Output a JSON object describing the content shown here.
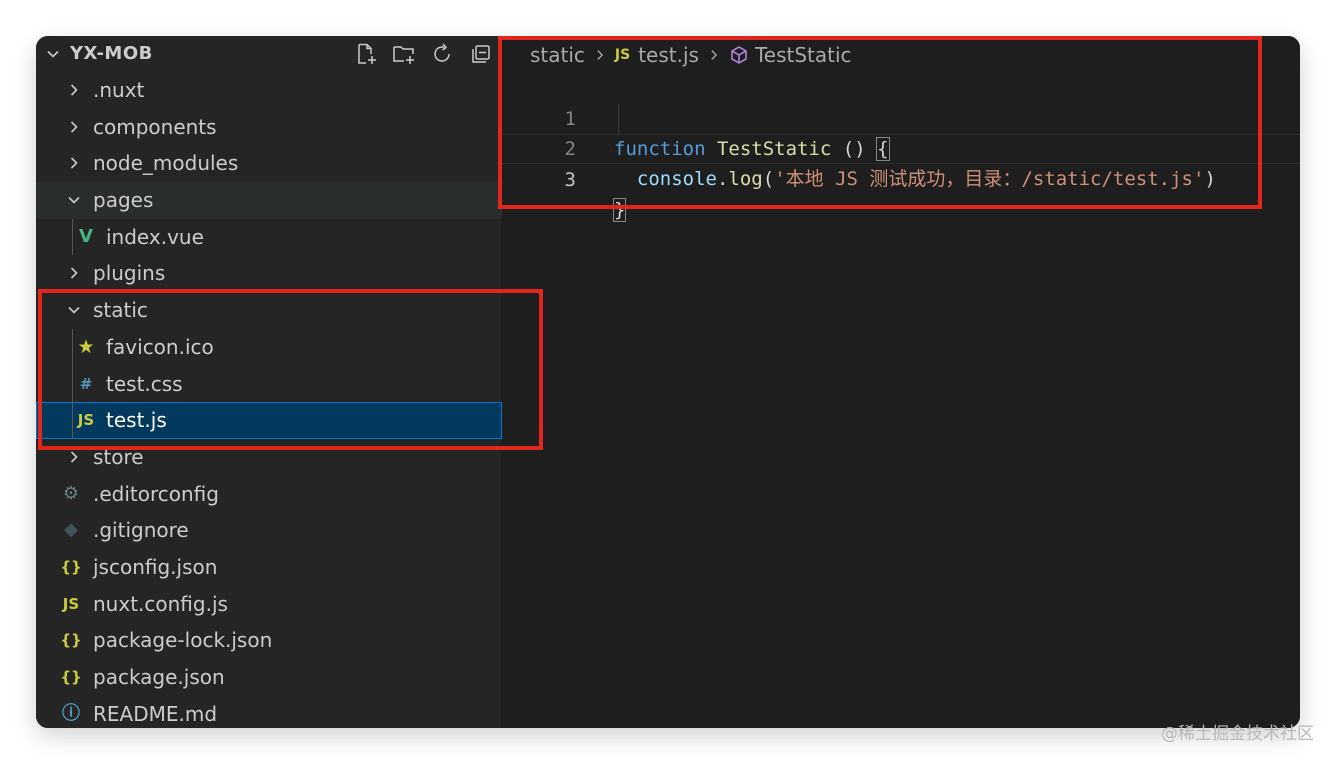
{
  "explorer": {
    "title": "YX-MOB",
    "items": [
      {
        "label": ".nuxt",
        "kind": "folder",
        "expanded": false,
        "depth": 0
      },
      {
        "label": "components",
        "kind": "folder",
        "expanded": false,
        "depth": 0
      },
      {
        "label": "node_modules",
        "kind": "folder",
        "expanded": false,
        "depth": 0
      },
      {
        "label": "pages",
        "kind": "folder",
        "expanded": true,
        "depth": 0
      },
      {
        "label": "index.vue",
        "kind": "file",
        "icon": "V",
        "icon_name": "vue-icon",
        "icon_color": "#41b883",
        "depth": 1
      },
      {
        "label": "plugins",
        "kind": "folder",
        "expanded": false,
        "depth": 0
      },
      {
        "label": "static",
        "kind": "folder",
        "expanded": true,
        "depth": 0
      },
      {
        "label": "favicon.ico",
        "kind": "file",
        "icon": "★",
        "icon_name": "star-icon",
        "icon_color": "#cbcb41",
        "depth": 1
      },
      {
        "label": "test.css",
        "kind": "file",
        "icon": "#",
        "icon_name": "css-icon",
        "icon_color": "#519aba",
        "depth": 1
      },
      {
        "label": "test.js",
        "kind": "file",
        "icon": "JS",
        "icon_name": "js-icon",
        "icon_color": "#cbcb41",
        "depth": 1,
        "selected": true
      },
      {
        "label": "store",
        "kind": "folder",
        "expanded": false,
        "depth": 0
      },
      {
        "label": ".editorconfig",
        "kind": "file",
        "icon": "⚙",
        "icon_name": "gear-icon",
        "icon_color": "#6d8086",
        "depth": 0
      },
      {
        "label": ".gitignore",
        "kind": "file",
        "icon": "◆",
        "icon_name": "git-icon",
        "icon_color": "#41535b",
        "depth": 0
      },
      {
        "label": "jsconfig.json",
        "kind": "file",
        "icon": "{}",
        "icon_name": "json-icon",
        "icon_color": "#cbcb41",
        "depth": 0
      },
      {
        "label": "nuxt.config.js",
        "kind": "file",
        "icon": "JS",
        "icon_name": "js-icon",
        "icon_color": "#cbcb41",
        "depth": 0
      },
      {
        "label": "package-lock.json",
        "kind": "file",
        "icon": "{}",
        "icon_name": "json-icon",
        "icon_color": "#cbcb41",
        "depth": 0
      },
      {
        "label": "package.json",
        "kind": "file",
        "icon": "{}",
        "icon_name": "json-icon",
        "icon_color": "#cbcb41",
        "depth": 0
      },
      {
        "label": "README.md",
        "kind": "file",
        "icon": "ⓘ",
        "icon_name": "info-icon",
        "icon_color": "#519aba",
        "depth": 0
      }
    ]
  },
  "breadcrumb": {
    "folder": "static",
    "file_badge": "JS",
    "file": "test.js",
    "symbol": "TestStatic"
  },
  "code": {
    "line_numbers": [
      "1",
      "2",
      "3"
    ],
    "line1": {
      "keyword": "function",
      "name": "TestStatic",
      "rest": " () ",
      "brace": "{"
    },
    "line2": {
      "indent": "  ",
      "object": "console",
      "dot": ".",
      "method": "log",
      "open": "(",
      "string": "'本地 JS 测试成功，目录：/static/test.js'",
      "close": ")"
    },
    "line3": {
      "brace": "}"
    }
  },
  "watermark": "@稀土掘金技术社区",
  "colors": {
    "sidebar_bg": "#252526",
    "editor_bg": "#1e1e1e",
    "selection_bg": "#04395e",
    "annotation_red": "#e0261d"
  }
}
